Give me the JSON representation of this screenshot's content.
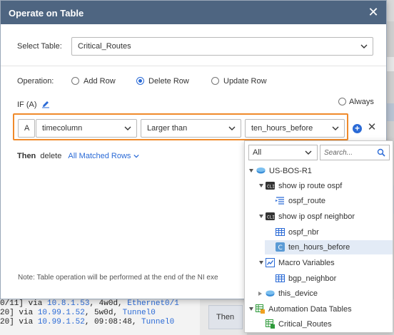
{
  "dialog": {
    "title": "Operate on Table",
    "close_glyph": "✕",
    "select_table_label": "Select Table:",
    "select_table_value": "Critical_Routes",
    "operation_label": "Operation:",
    "operations": [
      {
        "label": "Add Row",
        "checked": false
      },
      {
        "label": "Delete Row",
        "checked": true
      },
      {
        "label": "Update Row",
        "checked": false
      }
    ],
    "if_label": "IF (A)",
    "always_label": "Always",
    "condition": {
      "letter": "A",
      "column": "timecolumn",
      "operator": "Larger than",
      "value": "ten_hours_before"
    },
    "add_glyph": "+",
    "remove_glyph": "✕",
    "then_label": "Then",
    "then_action": "delete",
    "then_target": "All Matched Rows",
    "note": "Note: Table operation will be performed at the end of the NI exe"
  },
  "popup": {
    "filter_value": "All",
    "search_placeholder": "Search...",
    "tree": [
      {
        "label": "US-BOS-R1",
        "icon": "device-icon",
        "expanded": true
      },
      {
        "label": "show ip route ospf",
        "icon": "cli-icon",
        "expanded": true
      },
      {
        "label": "ospf_route",
        "icon": "route-table-icon"
      },
      {
        "label": "show ip ospf neighbor",
        "icon": "cli-icon",
        "expanded": true
      },
      {
        "label": "ospf_nbr",
        "icon": "table-icon"
      },
      {
        "label": "ten_hours_before",
        "icon": "variable-icon",
        "selected": true
      },
      {
        "label": "Macro Variables",
        "icon": "macro-icon",
        "expanded": true
      },
      {
        "label": "bgp_neighbor",
        "icon": "table-icon"
      },
      {
        "label": "this_device",
        "icon": "device-db-icon",
        "expanded": false
      },
      {
        "label": "Automation Data Tables",
        "icon": "data-tables-icon",
        "expanded": true
      },
      {
        "label": "Critical_Routes",
        "icon": "data-table-green-icon"
      }
    ]
  },
  "background": {
    "terminal_lines": [
      {
        "prefix": "0/11] via ",
        "ip": "10.8.1.53",
        "mid": ", 4w0d, ",
        "iface": "Ethernet0/1"
      },
      {
        "prefix": "20] via ",
        "ip": "10.99.1.52",
        "mid": ", 5w0d, ",
        "iface": "Tunnel0"
      },
      {
        "prefix": "20] via ",
        "ip": "10.99.1.52",
        "mid": ", 09:08:48, ",
        "iface": "Tunnel0"
      }
    ],
    "then_label": "Then"
  },
  "colors": {
    "title_bar": "#4e6581",
    "accent": "#2a6ad6",
    "highlight_border": "#f08a2a",
    "selected_row": "#e3ebf6"
  }
}
